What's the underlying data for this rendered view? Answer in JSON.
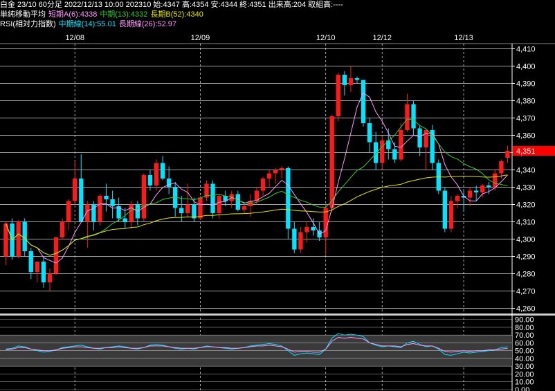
{
  "header": {
    "line1": "白金 23/10 60分足 2022/12/13 10:00 202310 始:4347 高:4354 安:4344 終:4351 出来高:204 取組高:----",
    "ma_title": "単純移動平均",
    "ma_short": "短期A(6):4338",
    "ma_mid": "中期(13):4332",
    "ma_long": "長期B(52):4340",
    "rsi_title": "RSI(相対力指数)",
    "rsi_mid": "中期線(14):55.01",
    "rsi_long": "長期線(26):52.97"
  },
  "colors": {
    "background": "#000000",
    "up_candle": "#ff1a1a",
    "down_candle": "#00e5ff",
    "ma_short": "#ff99ff",
    "ma_mid": "#33cc33",
    "ma_long": "#e6e600",
    "rsi_mid": "#00e5ff",
    "rsi_long": "#ff99ff",
    "grid": "#ffffff",
    "price_tag": "#ff0000"
  },
  "chart_data": [
    {
      "type": "candlestick",
      "title": "",
      "ylim": [
        4257,
        4413
      ],
      "y_ticks": [
        "4,410",
        "4,400",
        "4,390",
        "4,380",
        "4,370",
        "4,360",
        "4,350",
        "4,340",
        "4,330",
        "4,320",
        "4,310",
        "4,300",
        "4,290",
        "4,280",
        "4,270",
        "4,260"
      ],
      "last_price_label": "4,351",
      "date_labels": [
        "12/08",
        "12/09",
        "12/10",
        "12/12",
        "12/13"
      ],
      "candles": [
        {
          "o": 4290,
          "h": 4310,
          "l": 4285,
          "c": 4309
        },
        {
          "o": 4309,
          "h": 4312,
          "l": 4288,
          "c": 4290
        },
        {
          "o": 4290,
          "h": 4311,
          "l": 4289,
          "c": 4310
        },
        {
          "o": 4310,
          "h": 4312,
          "l": 4290,
          "c": 4293
        },
        {
          "o": 4293,
          "h": 4295,
          "l": 4277,
          "c": 4281
        },
        {
          "o": 4281,
          "h": 4285,
          "l": 4275,
          "c": 4287
        },
        {
          "o": 4287,
          "h": 4289,
          "l": 4272,
          "c": 4275
        },
        {
          "o": 4275,
          "h": 4283,
          "l": 4270,
          "c": 4280
        },
        {
          "o": 4280,
          "h": 4300,
          "l": 4279,
          "c": 4301
        },
        {
          "o": 4301,
          "h": 4312,
          "l": 4300,
          "c": 4310
        },
        {
          "o": 4310,
          "h": 4323,
          "l": 4305,
          "c": 4322
        },
        {
          "o": 4322,
          "h": 4345,
          "l": 4320,
          "c": 4335
        },
        {
          "o": 4335,
          "h": 4349,
          "l": 4310,
          "c": 4310
        },
        {
          "o": 4310,
          "h": 4322,
          "l": 4295,
          "c": 4320
        },
        {
          "o": 4320,
          "h": 4322,
          "l": 4305,
          "c": 4310
        },
        {
          "o": 4310,
          "h": 4326,
          "l": 4308,
          "c": 4325
        },
        {
          "o": 4325,
          "h": 4332,
          "l": 4316,
          "c": 4323
        },
        {
          "o": 4323,
          "h": 4328,
          "l": 4312,
          "c": 4319
        },
        {
          "o": 4319,
          "h": 4324,
          "l": 4310,
          "c": 4312
        },
        {
          "o": 4312,
          "h": 4318,
          "l": 4306,
          "c": 4310
        },
        {
          "o": 4310,
          "h": 4322,
          "l": 4306,
          "c": 4320
        },
        {
          "o": 4320,
          "h": 4322,
          "l": 4308,
          "c": 4312
        },
        {
          "o": 4312,
          "h": 4338,
          "l": 4310,
          "c": 4337
        },
        {
          "o": 4337,
          "h": 4340,
          "l": 4328,
          "c": 4331
        },
        {
          "o": 4331,
          "h": 4346,
          "l": 4328,
          "c": 4344
        },
        {
          "o": 4344,
          "h": 4348,
          "l": 4334,
          "c": 4335
        },
        {
          "o": 4335,
          "h": 4342,
          "l": 4326,
          "c": 4330
        },
        {
          "o": 4330,
          "h": 4333,
          "l": 4313,
          "c": 4318
        },
        {
          "o": 4318,
          "h": 4325,
          "l": 4310,
          "c": 4315
        },
        {
          "o": 4315,
          "h": 4332,
          "l": 4313,
          "c": 4320
        },
        {
          "o": 4320,
          "h": 4324,
          "l": 4310,
          "c": 4312
        },
        {
          "o": 4312,
          "h": 4325,
          "l": 4311,
          "c": 4324
        },
        {
          "o": 4324,
          "h": 4334,
          "l": 4322,
          "c": 4332
        },
        {
          "o": 4332,
          "h": 4334,
          "l": 4312,
          "c": 4315
        },
        {
          "o": 4315,
          "h": 4326,
          "l": 4312,
          "c": 4325
        },
        {
          "o": 4325,
          "h": 4328,
          "l": 4319,
          "c": 4322
        },
        {
          "o": 4322,
          "h": 4328,
          "l": 4318,
          "c": 4326
        },
        {
          "o": 4326,
          "h": 4328,
          "l": 4316,
          "c": 4317
        },
        {
          "o": 4317,
          "h": 4320,
          "l": 4315,
          "c": 4319
        },
        {
          "o": 4319,
          "h": 4326,
          "l": 4313,
          "c": 4322
        },
        {
          "o": 4322,
          "h": 4330,
          "l": 4320,
          "c": 4328
        },
        {
          "o": 4328,
          "h": 4336,
          "l": 4325,
          "c": 4335
        },
        {
          "o": 4335,
          "h": 4340,
          "l": 4330,
          "c": 4338
        },
        {
          "o": 4338,
          "h": 4341,
          "l": 4332,
          "c": 4340
        },
        {
          "o": 4340,
          "h": 4342,
          "l": 4335,
          "c": 4341
        },
        {
          "o": 4341,
          "h": 4342,
          "l": 4300,
          "c": 4306
        },
        {
          "o": 4306,
          "h": 4310,
          "l": 4292,
          "c": 4294
        },
        {
          "o": 4294,
          "h": 4307,
          "l": 4292,
          "c": 4304
        },
        {
          "o": 4304,
          "h": 4310,
          "l": 4298,
          "c": 4307
        },
        {
          "o": 4307,
          "h": 4312,
          "l": 4302,
          "c": 4305
        },
        {
          "o": 4305,
          "h": 4310,
          "l": 4299,
          "c": 4301
        },
        {
          "o": 4301,
          "h": 4320,
          "l": 4291,
          "c": 4318
        },
        {
          "o": 4318,
          "h": 4372,
          "l": 4316,
          "c": 4371
        },
        {
          "o": 4371,
          "h": 4396,
          "l": 4368,
          "c": 4395
        },
        {
          "o": 4395,
          "h": 4397,
          "l": 4383,
          "c": 4389
        },
        {
          "o": 4389,
          "h": 4400,
          "l": 4385,
          "c": 4393
        },
        {
          "o": 4393,
          "h": 4394,
          "l": 4390,
          "c": 4392
        },
        {
          "o": 4392,
          "h": 4392,
          "l": 4365,
          "c": 4367
        },
        {
          "o": 4367,
          "h": 4370,
          "l": 4350,
          "c": 4356
        },
        {
          "o": 4356,
          "h": 4362,
          "l": 4340,
          "c": 4344
        },
        {
          "o": 4344,
          "h": 4360,
          "l": 4340,
          "c": 4357
        },
        {
          "o": 4357,
          "h": 4364,
          "l": 4346,
          "c": 4352
        },
        {
          "o": 4352,
          "h": 4356,
          "l": 4344,
          "c": 4346
        },
        {
          "o": 4346,
          "h": 4367,
          "l": 4345,
          "c": 4363
        },
        {
          "o": 4363,
          "h": 4384,
          "l": 4362,
          "c": 4378
        },
        {
          "o": 4378,
          "h": 4380,
          "l": 4360,
          "c": 4364
        },
        {
          "o": 4364,
          "h": 4366,
          "l": 4348,
          "c": 4353
        },
        {
          "o": 4353,
          "h": 4364,
          "l": 4340,
          "c": 4363
        },
        {
          "o": 4363,
          "h": 4366,
          "l": 4340,
          "c": 4344
        },
        {
          "o": 4344,
          "h": 4346,
          "l": 4326,
          "c": 4328
        },
        {
          "o": 4328,
          "h": 4330,
          "l": 4304,
          "c": 4306
        },
        {
          "o": 4306,
          "h": 4325,
          "l": 4304,
          "c": 4322
        },
        {
          "o": 4322,
          "h": 4326,
          "l": 4318,
          "c": 4325
        },
        {
          "o": 4325,
          "h": 4328,
          "l": 4316,
          "c": 4324
        },
        {
          "o": 4324,
          "h": 4330,
          "l": 4319,
          "c": 4328
        },
        {
          "o": 4328,
          "h": 4331,
          "l": 4322,
          "c": 4327
        },
        {
          "o": 4327,
          "h": 4332,
          "l": 4324,
          "c": 4331
        },
        {
          "o": 4331,
          "h": 4333,
          "l": 4326,
          "c": 4330
        },
        {
          "o": 4330,
          "h": 4340,
          "l": 4328,
          "c": 4338
        },
        {
          "o": 4338,
          "h": 4346,
          "l": 4335,
          "c": 4345
        },
        {
          "o": 4347,
          "h": 4354,
          "l": 4344,
          "c": 4351
        }
      ],
      "ma_short_label": "短期A(6)",
      "ma_mid_label": "中期(13)",
      "ma_long_label": "長期B(52)"
    },
    {
      "type": "line",
      "title": "RSI(相対力指数)",
      "ylim": [
        0,
        95
      ],
      "y_ticks": [
        "90.00",
        "80.00",
        "70.00",
        "60.00",
        "50.00",
        "40.00",
        "30.00",
        "20.00",
        "10.00",
        "0.00"
      ],
      "band": [
        30,
        70
      ],
      "series": [
        {
          "name": "中期線(14)",
          "values": [
            52,
            53,
            56,
            55,
            52,
            50,
            48,
            49,
            51,
            54,
            55,
            56,
            57,
            55,
            53,
            52,
            54,
            55,
            56,
            55,
            53,
            52,
            54,
            57,
            58,
            57,
            55,
            53,
            52,
            53,
            52,
            54,
            56,
            55,
            54,
            53,
            52,
            53,
            54,
            56,
            57,
            58,
            59,
            58,
            56,
            50,
            44,
            46,
            47,
            46,
            45,
            52,
            66,
            72,
            70,
            71,
            70,
            68,
            60,
            57,
            55,
            56,
            55,
            54,
            60,
            62,
            58,
            55,
            56,
            52,
            45,
            44,
            46,
            48,
            47,
            48,
            49,
            50,
            51,
            54,
            55
          ]
        },
        {
          "name": "長期線(26)",
          "values": [
            51,
            52,
            54,
            54,
            52,
            51,
            50,
            50,
            51,
            53,
            54,
            55,
            55,
            54,
            53,
            53,
            54,
            54,
            55,
            54,
            53,
            53,
            54,
            56,
            56,
            56,
            55,
            54,
            53,
            53,
            53,
            54,
            55,
            55,
            54,
            54,
            53,
            53,
            54,
            55,
            56,
            56,
            57,
            56,
            55,
            52,
            48,
            49,
            49,
            48,
            48,
            52,
            62,
            67,
            66,
            67,
            66,
            65,
            60,
            58,
            56,
            56,
            56,
            55,
            58,
            59,
            57,
            56,
            56,
            53,
            49,
            48,
            49,
            50,
            49,
            50,
            50,
            51,
            51,
            52,
            53
          ]
        }
      ]
    }
  ]
}
